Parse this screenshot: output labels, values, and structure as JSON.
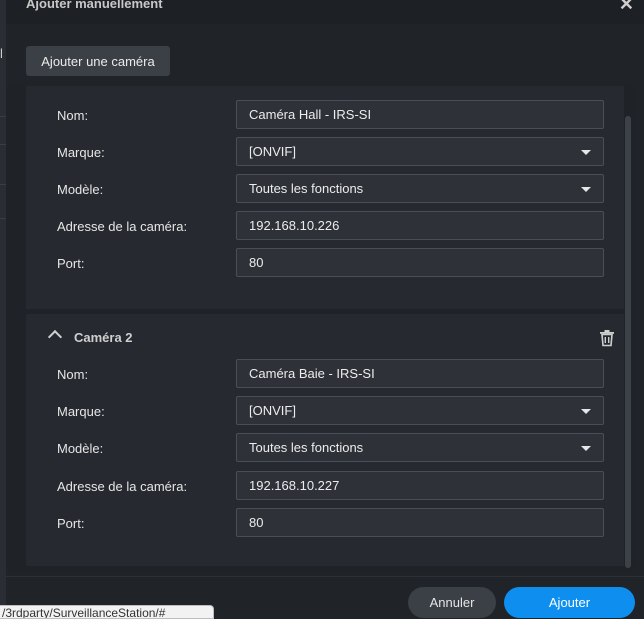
{
  "background": {
    "left_char": "l",
    "url": "/3rdparty/SurveillanceStation/#"
  },
  "dialog": {
    "title": "Ajouter manuellement",
    "add_camera_label": "Ajouter une caméra"
  },
  "labels": {
    "name": "Nom:",
    "brand": "Marque:",
    "model": "Modèle:",
    "address": "Adresse de la caméra:",
    "port": "Port:"
  },
  "camera1": {
    "name": "Caméra Hall - IRS-SI",
    "brand": "[ONVIF]",
    "model": "Toutes les fonctions",
    "address": "192.168.10.226",
    "port": "80"
  },
  "camera2": {
    "title": "Caméra 2",
    "name": "Caméra Baie - IRS-SI",
    "brand": "[ONVIF]",
    "model": "Toutes les fonctions",
    "address": "192.168.10.227",
    "port": "80"
  },
  "footer": {
    "cancel": "Annuler",
    "add": "Ajouter"
  },
  "colors": {
    "accent": "#0e8ff0",
    "panel": "#26292f",
    "background": "#1f2227"
  }
}
